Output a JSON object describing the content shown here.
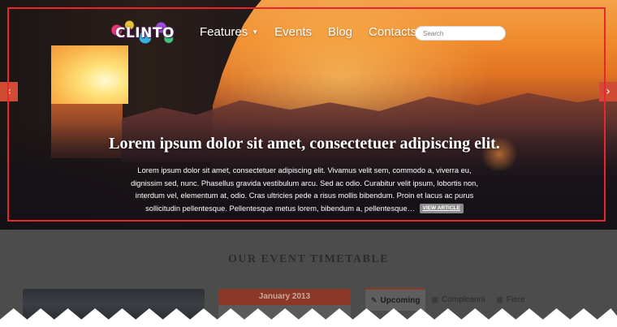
{
  "logo": {
    "text": "CLINTO"
  },
  "nav": {
    "items": [
      {
        "label": "Features",
        "has_dropdown": true
      },
      {
        "label": "Events"
      },
      {
        "label": "Blog"
      },
      {
        "label": "Contacts"
      }
    ]
  },
  "search": {
    "placeholder": "Search",
    "value": ""
  },
  "slider": {
    "prev_arrow": "‹",
    "next_arrow": "›",
    "caption_title": "Lorem ipsum dolor sit amet, consectetuer adipiscing elit.",
    "caption_body": "Lorem ipsum dolor sit amet, consectetuer adipiscing elit. Vivamus velit sem, commodo a, viverra eu, dignissim sed, nunc. Phasellus gravida vestibulum arcu. Sed ac odio. Curabitur velit ipsum, lobortis non, interdum vel, elementum at, odio. Cras ultricies pede a risus mollis bibendum. Proin et lacus ac purus sollicitudin pellentesque. Pellentesque metus lorem, bibendum a, pellentesque…",
    "view_button": "VIEW ARTICLE"
  },
  "events": {
    "section_title": "OUR EVENT TIMETABLE",
    "calendar_month": "January 2013",
    "tabs": [
      {
        "label": "Upcoming",
        "icon": "pin-icon",
        "active": true
      },
      {
        "label": "Compleanni",
        "icon": "calendar-icon",
        "active": false
      },
      {
        "label": "Fiere",
        "icon": "calendar-icon",
        "active": false
      }
    ]
  },
  "colors": {
    "accent": "#d24b35",
    "highlight_frame": "#e8262d",
    "calendar_header": "#8b3826"
  }
}
